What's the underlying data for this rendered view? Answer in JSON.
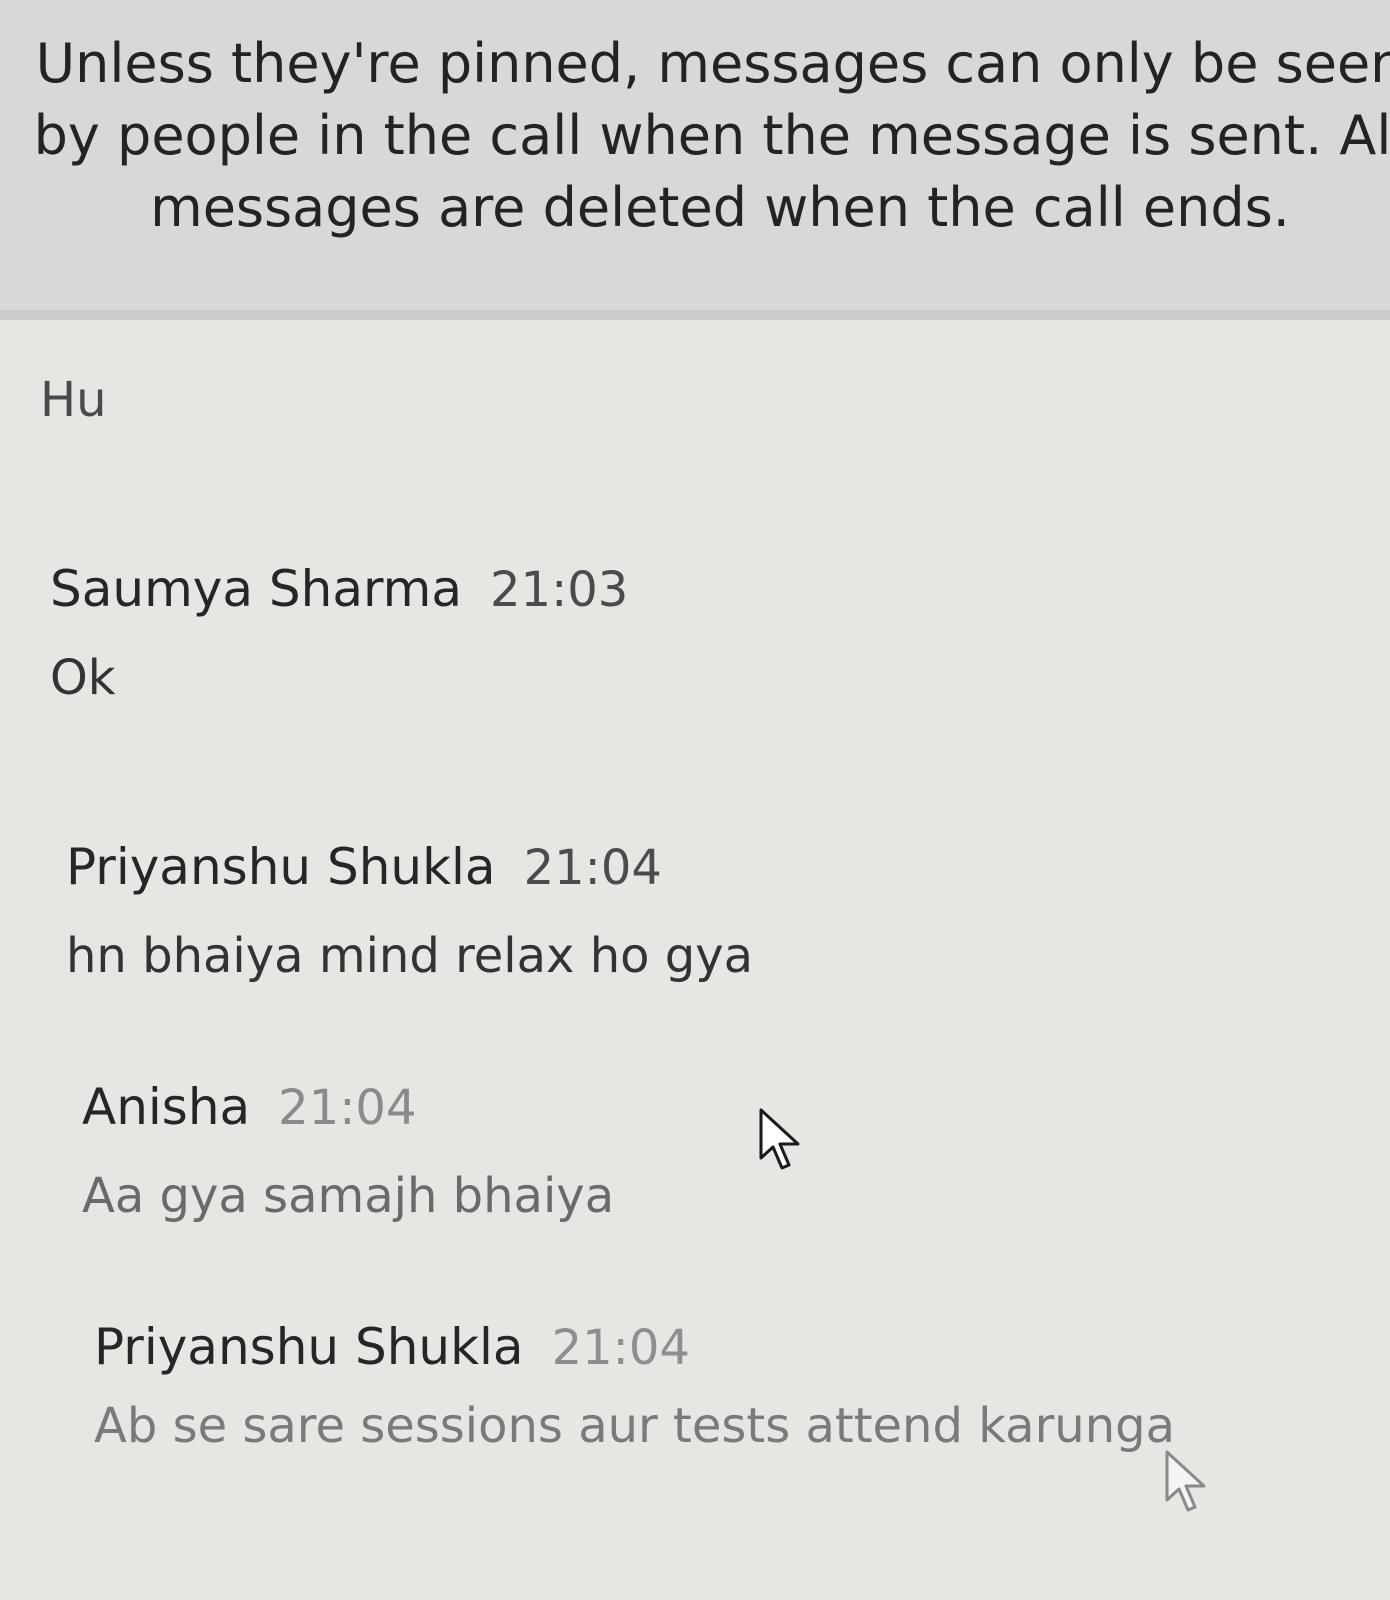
{
  "notice": {
    "text": "Unless they're pinned, messages can only be seen by people in the call when the message is sent. All messages are deleted when the call ends."
  },
  "stray_text": "Hu",
  "messages": [
    {
      "sender": "Saumya Sharma",
      "time": "21:03",
      "text": "Ok"
    },
    {
      "sender": "Priyanshu Shukla",
      "time": "21:04",
      "text": "hn bhaiya  mind relax ho gya"
    },
    {
      "sender": "Anisha",
      "time": "21:04",
      "text": "Aa gya samajh bhaiya"
    },
    {
      "sender": "Priyanshu Shukla",
      "time": "21:04",
      "text": "Ab se sare sessions aur tests attend karunga"
    }
  ],
  "icons": {
    "cursor": "mouse-pointer-icon"
  }
}
